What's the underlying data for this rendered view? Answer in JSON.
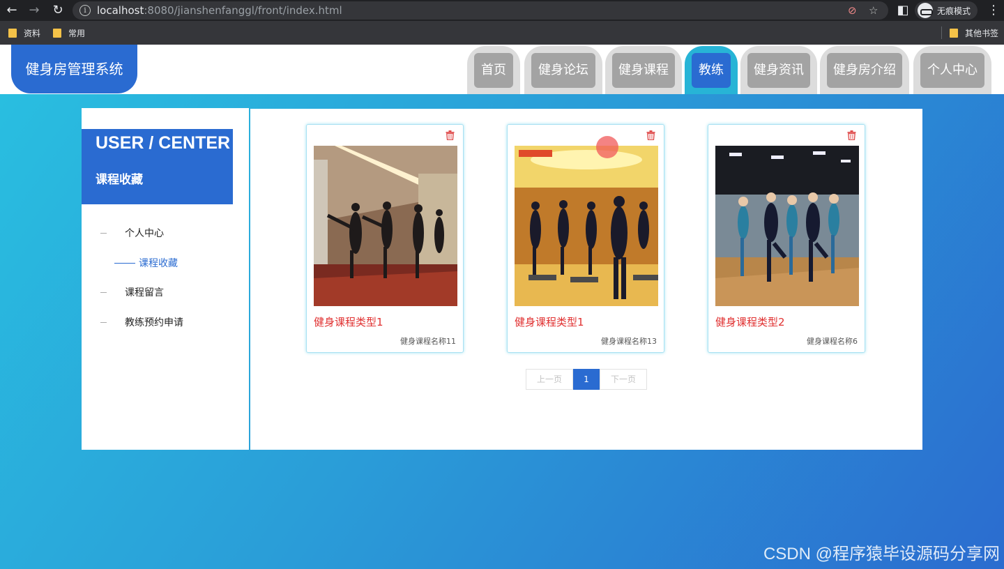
{
  "browser": {
    "url_host": "localhost",
    "url_rest": ":8080/jianshenfanggl/front/index.html",
    "incognito_label": "无痕模式",
    "bookmarks": [
      "资料",
      "常用"
    ],
    "other_bookmarks": "其他书签"
  },
  "header": {
    "logo": "健身房管理系统",
    "nav": [
      "首页",
      "健身论坛",
      "健身课程",
      "教练",
      "健身资讯",
      "健身房介绍",
      "个人中心"
    ],
    "active_nav": "教练"
  },
  "sidebar": {
    "title": "USER / CENTER",
    "subtitle": "课程收藏",
    "items": [
      "个人中心",
      "课程收藏",
      "课程留言",
      "教练预约申请"
    ],
    "active_item": "课程收藏"
  },
  "cards": [
    {
      "type": "健身课程类型1",
      "name": "健身课程名称11"
    },
    {
      "type": "健身课程类型1",
      "name": "健身课程名称13"
    },
    {
      "type": "健身课程类型2",
      "name": "健身课程名称6"
    }
  ],
  "pager": {
    "prev": "上一页",
    "current": "1",
    "next": "下一页"
  },
  "watermark": "CSDN @程序猿毕设源码分享网",
  "colors": {
    "primary": "#2a6bd1",
    "accent": "#27b4d6",
    "card_type_text": "#e03030"
  }
}
